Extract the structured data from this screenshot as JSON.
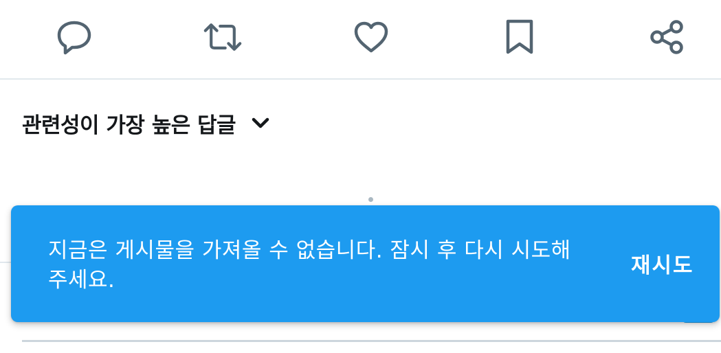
{
  "actions": {
    "reply_icon": "speech-bubble-icon",
    "retweet_icon": "retweet-arrows-icon",
    "like_icon": "heart-icon",
    "bookmark_icon": "bookmark-icon",
    "share_icon": "share-nodes-icon"
  },
  "sort": {
    "label": "관련성이 가장 높은 답글",
    "chevron_icon": "chevron-down-icon"
  },
  "toast": {
    "message": "지금은 게시물을 가져올 수 없습니다. 잠시 후 다시 시도해 주세요.",
    "action_label": "재시도"
  },
  "colors": {
    "icon": "#536471",
    "text_primary": "#14171a",
    "toast_bg": "#1d9bf0",
    "divider": "#e1e8ed"
  }
}
